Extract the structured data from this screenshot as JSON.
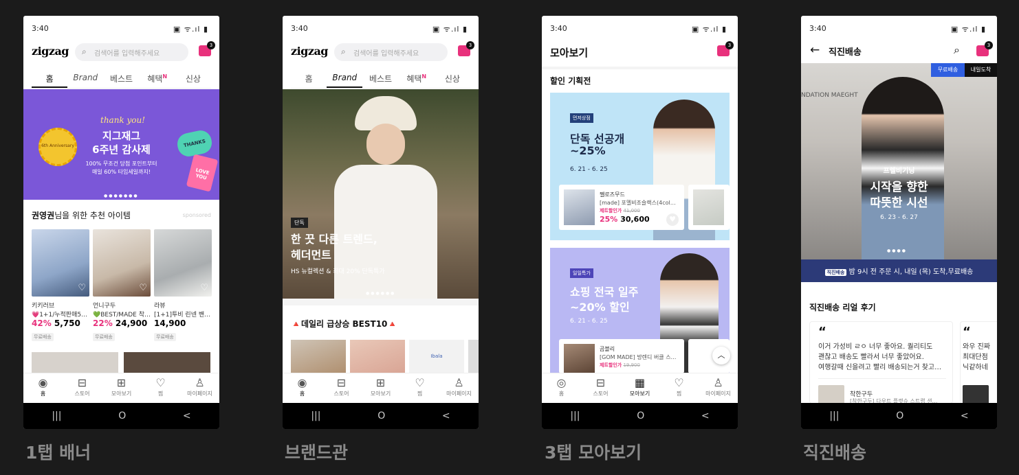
{
  "captions": [
    "1탭 배너",
    "브랜드관",
    "3탭 모아보기",
    "직진배송"
  ],
  "status": {
    "time": "3:40",
    "icons": "▣ ᯤ.ıl ▮",
    "cart_count": "3"
  },
  "logo": "zigzag",
  "search_placeholder": "검색어를 입력해주세요",
  "tabs": [
    "홈",
    "Brand",
    "베스트",
    "혜택",
    "신상"
  ],
  "tab_badge": "N",
  "bottom_nav": [
    "홈",
    "스토어",
    "모아보기",
    "찜",
    "마이페이지"
  ],
  "system_nav": [
    "|||",
    "O",
    "<"
  ],
  "s1": {
    "banner": {
      "script": "thank you!",
      "title1": "지그재그",
      "title2": "6주년 감사제",
      "sub1": "100% 무조건 당첨 포인트부터",
      "sub2": "매일 60% 타임세일까지!",
      "sticker": "THANKS",
      "tag": "LOVE YOU",
      "seal": "6th Anniversary"
    },
    "section_title_name": "권영권",
    "section_title_rest": "님을 위한 추천 아이템",
    "sponsored": "sponsored",
    "products": [
      {
        "brand": "키키러브",
        "name": "💗1+1/누적판매5…",
        "discount": "42%",
        "price": "5,750",
        "tag": "무료배송"
      },
      {
        "brand": "언니구두",
        "name": "💚BEST/MADE 착…",
        "discount": "22%",
        "price": "24,900",
        "tag": "무료배송"
      },
      {
        "brand": "라뷰",
        "name": "[1+1]투비 린넨 밴…",
        "discount": "",
        "price": "14,900",
        "tag": "무료배송"
      }
    ]
  },
  "s2": {
    "badge": "단독",
    "title1": "한 끗 다른 트렌드,",
    "title2": "헤더먼트",
    "sub": "HS 뉴컬렉션 & 최대 20% 단독특가",
    "section_title": "🔺데일리 급상승 BEST10🔺",
    "thumb_label": "Ibala"
  },
  "s3": {
    "header_title": "모아보기",
    "section_title": "할인 기획전",
    "cards": [
      {
        "badge": "먼저상점",
        "title1": "단독 선공개",
        "title2": "~25%",
        "date": "6. 21 - 6. 25",
        "brand": "쩰로즈무드",
        "name": "[made] 포멜비조슬랙스(4col…",
        "label": "제트할인가",
        "orig": "41,000",
        "discount": "25%",
        "price": "30,600"
      },
      {
        "badge": "일일특가",
        "title1": "쇼핑 전국 일주",
        "title2": "~20% 할인",
        "date": "6. 21 - 6. 25",
        "brand": "곰블리",
        "name": "[GOM MADE] 방렌디 버클 스…",
        "label": "제트할인가",
        "orig": "19,900"
      }
    ]
  },
  "s4": {
    "header_title": "직진배송",
    "badge_free": "무료배송",
    "badge_next": "내일도착",
    "store_sign": "NDATION MAEGHT",
    "banner_brand": "프렐비기닝",
    "title1": "시작을 향한",
    "title2": "따뜻한 시선",
    "date": "6. 23 - 6. 27",
    "strip_badge": "직진배송",
    "strip_text": "밤 9시 전 주문 시, 내일 (목) 도착,무료배송",
    "reviews_title": "직진배송 리얼 후기",
    "quote": "“",
    "review1_l1": "이거 가성비 ㄹㅇ 너무 좋아요. 퀄리티도",
    "review1_l2": "괜찮고 배송도 빨라서 너무 좋았어요.",
    "review1_l3": "여행갈때 신을려고 빨리 배송되는거 찾고…",
    "review1_user": "착한구두",
    "review1_product": "[착한구두] 다우트 플랫슈 스트랩 샌…",
    "review2_l1": "와우 진짜",
    "review2_l2": "최대단점",
    "review2_l3": "닉같하네"
  },
  "colors": {
    "accent": "#e8317c",
    "banner_purple": "#7b57d8",
    "card_blue": "#bfe4f7",
    "card_lavender": "#b9b8f3",
    "strip_navy": "#2c3a78"
  }
}
